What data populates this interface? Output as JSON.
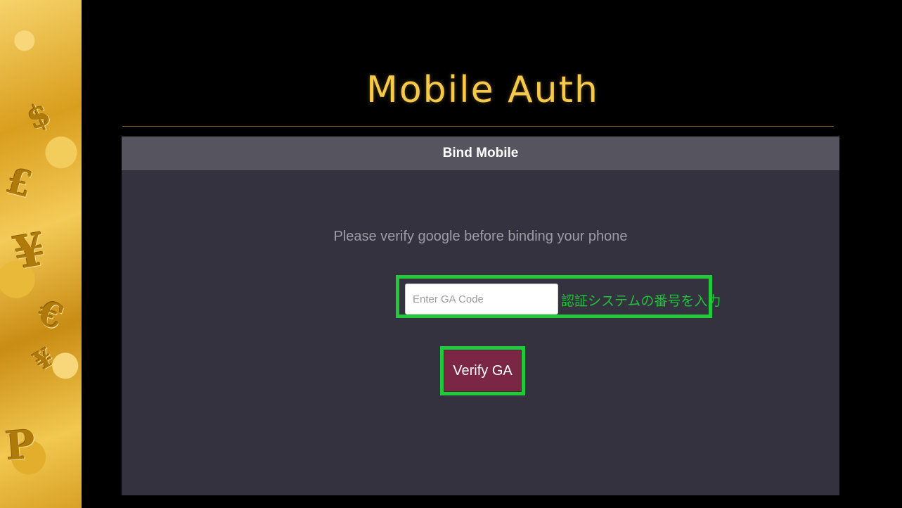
{
  "slide": {
    "title": "Mobile Auth"
  },
  "panel": {
    "header": "Bind Mobile",
    "message": "Please verify google before binding your phone",
    "ga_input": {
      "value": "",
      "placeholder": "Enter GA Code"
    },
    "annotation": "認証システムの番号を入力",
    "verify_button_label": "Verify GA"
  },
  "decoration": {
    "currency_symbols": [
      "$",
      "£",
      "¥",
      "€",
      "¥",
      "P"
    ]
  },
  "colors": {
    "background": "#000000",
    "title": "#f6c94a",
    "panel": "#33323e",
    "panel_header": "#55545f",
    "highlight": "#22c93b",
    "button": "#7a2644"
  }
}
